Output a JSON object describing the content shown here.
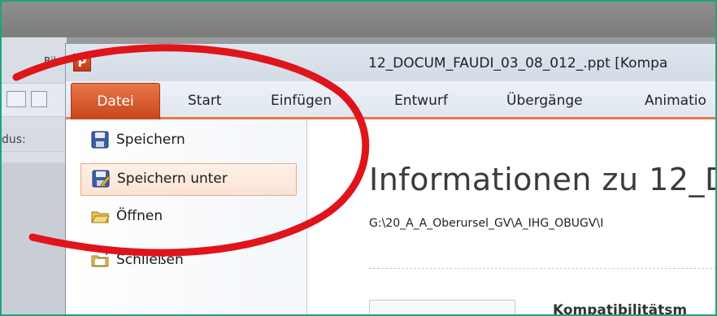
{
  "background_window": {
    "title_fragment": "Bil",
    "label_fragment": "dus:"
  },
  "window": {
    "app_icon_letter": "P",
    "title": "12_DOCUM_FAUDI_03_08_012_.ppt [Kompa"
  },
  "ribbon": {
    "tabs": [
      "Datei",
      "Start",
      "Einfügen",
      "Entwurf",
      "Übergänge",
      "Animatio"
    ]
  },
  "file_menu": {
    "items": [
      {
        "label": "Speichern",
        "icon": "save-icon"
      },
      {
        "label": "Speichern unter",
        "icon": "save-as-icon",
        "active": true
      },
      {
        "label": "Öffnen",
        "icon": "open-folder-icon"
      },
      {
        "label": "Schließen",
        "icon": "close-folder-icon"
      }
    ]
  },
  "info_panel": {
    "heading": "Informationen zu 12_DO",
    "path": "G:\\20_A_A_Oberursel_GV\\A_IHG_OBUGV\\I",
    "section_title": "Kompatibilitätsm"
  },
  "colors": {
    "file_tab": "#d65a2c",
    "annotation": "#e0141b",
    "frame_border": "#1fa37a"
  }
}
